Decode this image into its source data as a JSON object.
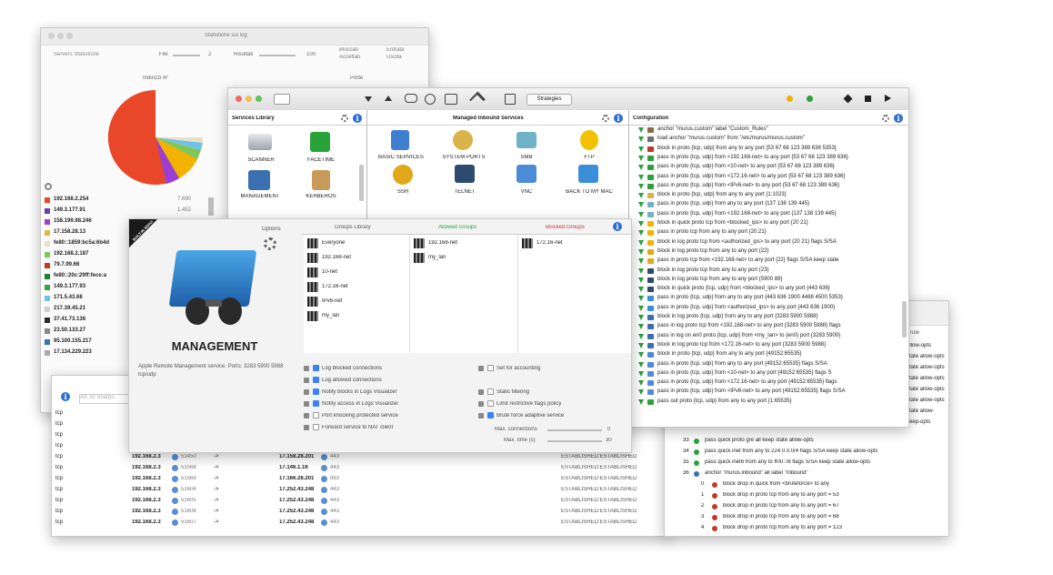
{
  "stats_window": {
    "title": "Statistiche sul log",
    "toolbar": {
      "servers_label": "Servers Statistiche",
      "file_label": "File",
      "file_value": "2",
      "results_label": "Risultati",
      "results_value": "100",
      "radios": [
        "Bloccati",
        "Accettati",
        "Entrata",
        "Uscita"
      ]
    },
    "pie_title": "Indirizzi IP",
    "ports_title": "Porte",
    "legend": [
      {
        "ip": "192.168.2.254",
        "value": "7.690",
        "color": "#e8472a"
      },
      {
        "ip": "149.3.177.91",
        "value": "1.452",
        "color": "#6a3fa8"
      },
      {
        "ip": "158.199.98.246",
        "value": "",
        "color": "#9b3fd0"
      },
      {
        "ip": "17.158.28.13",
        "value": "",
        "color": "#d8c13a"
      },
      {
        "ip": "fe80::1859:bc5a:6b4d",
        "value": "",
        "color": "#e8e0c6"
      },
      {
        "ip": "192.168.2.187",
        "value": "",
        "color": "#7ec85a"
      },
      {
        "ip": "79.7.99.66",
        "value": "",
        "color": "#c1392b"
      },
      {
        "ip": "fe80::20c:29ff:fece:a",
        "value": "",
        "color": "#1d7f3a"
      },
      {
        "ip": "149.3.177.93",
        "value": "",
        "color": "#3aa04a"
      },
      {
        "ip": "171.5.43.68",
        "value": "",
        "color": "#6fc1e8"
      },
      {
        "ip": "217.39.45.21",
        "value": "",
        "color": "#d0d0d0"
      },
      {
        "ip": "37.41.73.136",
        "value": "",
        "color": "#2a2a2a"
      },
      {
        "ip": "23.50.133.27",
        "value": "",
        "color": "#888888"
      },
      {
        "ip": "95.100.155.217",
        "value": "",
        "color": "#3a6fb0"
      },
      {
        "ip": "17.134.229.223",
        "value": "",
        "color": "#aaaaaa"
      }
    ]
  },
  "conn_window": {
    "search_placeholder": "Ad. ID Snarpo",
    "rows": [
      {
        "proto": "tcp",
        "src": "192.168.2.3",
        "sport": "51450",
        "arrow": "->",
        "dst": "17.158.28.201",
        "dport": "443",
        "state": "ESTABLISHED:ESTABLISHED"
      },
      {
        "proto": "tcp",
        "src": "192.168.2.3",
        "sport": "51568",
        "arrow": "->",
        "dst": "17.146.1.16",
        "dport": "443",
        "state": "ESTABLISHED:ESTABLISHED"
      },
      {
        "proto": "tcp",
        "src": "192.168.2.3",
        "sport": "51569",
        "arrow": "->",
        "dst": "17.166.28.201",
        "dport": "993",
        "state": "ESTABLISHED:ESTABLISHED"
      },
      {
        "proto": "tcp",
        "src": "192.168.2.3",
        "sport": "51604",
        "arrow": "->",
        "dst": "17.252.43.248",
        "dport": "443",
        "state": "ESTABLISHED:ESTABLISHED"
      },
      {
        "proto": "tcp",
        "src": "192.168.2.3",
        "sport": "51605",
        "arrow": "->",
        "dst": "17.252.43.248",
        "dport": "443",
        "state": "ESTABLISHED:ESTABLISHED"
      },
      {
        "proto": "tcp",
        "src": "192.168.2.3",
        "sport": "51606",
        "arrow": "->",
        "dst": "17.252.43.248",
        "dport": "443",
        "state": "ESTABLISHED:ESTABLISHED"
      },
      {
        "proto": "tcp",
        "src": "192.168.2.3",
        "sport": "51607",
        "arrow": "->",
        "dst": "17.252.43.248",
        "dport": "443",
        "state": "ESTABLISHED:ESTABLISHED"
      }
    ]
  },
  "rules_window": {
    "header": "rule",
    "right_frag": [
      "allow-opts",
      "state allow-opts",
      "state allow-opts",
      "state allow-opts",
      "state allow-opts",
      "state allow-opts",
      "state allow-",
      "keep-opts"
    ],
    "rows": [
      {
        "num": "33",
        "text": "pass quick proto gre all keep state allow-opts"
      },
      {
        "num": "34",
        "text": "pass quick inet from any to 224.0.0.0/4 flags S/SA keep state allow-opts"
      },
      {
        "num": "35",
        "text": "pass quick inet6 from any to ff00::/8 flags S/SA keep state allow-opts"
      },
      {
        "num": "36",
        "text": "anchor \"murus.inbound\" all label \"Inbound\""
      },
      {
        "num": "0",
        "text": "block drop in quick from <bruteforce> to any"
      },
      {
        "num": "1",
        "text": "block drop in proto tcp from any to any port = 53"
      },
      {
        "num": "2",
        "text": "block drop in proto tcp from any to any port = 67"
      },
      {
        "num": "3",
        "text": "block drop in proto tcp from any to any port = 68"
      },
      {
        "num": "4",
        "text": "block drop in proto tcp from any to any port = 123"
      }
    ]
  },
  "main_window": {
    "toolbar_button": "Strategies",
    "services_library_title": "Services Library",
    "managed_title": "Managed Inbound Services",
    "config_title": "Configuration",
    "library_items": [
      "SCANNER",
      "FACETIME",
      "MANAGEMENT",
      "KERBEROS"
    ],
    "managed_items": [
      "BASIC SERVICES",
      "SYSTEM PORTS",
      "SMB",
      "FTP",
      "SSH",
      "TELNET",
      "VNC",
      "BACK TO MY MAC"
    ],
    "config_lines": [
      "anchor \"murus.custom\" label \"Custom_Rules\"",
      "load anchor \"murus.custom\" from \"/etc/murus/murus.custom\"",
      "block in proto {tcp, udp} from any to any port {53 67 68 123 389 636 5353}",
      "pass in proto {tcp, udp} from <192.168-net> to any port {53 67 68 123 389 636}",
      "pass in proto {tcp, udp} from <10-net> to any port {53 67 68 123 389 636}",
      "pass in proto {tcp, udp} from <172.16-net> to any port {53 67 68 123 389 636}",
      "pass in proto {tcp, udp} from <IPv6-net> to any port {53 67 68 123 389 636}",
      "block in proto {tcp, udp} from any to any port {1:1023}",
      "pass in proto {tcp, udp} from any to any port {137 138 139 445}",
      "pass in proto {tcp, udp} from <192.168-net> to any port {137 138 139 445}",
      "block in quick proto tcp from <blocked_ips> to any port {20 21}",
      "pass in proto tcp from any to any port {20:21}",
      "block in log proto tcp from <authorized_ips> to any port {20 21} flags S/SA",
      "block in log proto tcp from any to any port {22}",
      "pass in proto tcp from <192.168-net> to any port {22} flags S/SA keep state",
      "block in log proto tcp from any to any port {23}",
      "block in log proto tcp from any to any port {5900 88}",
      "block in quick proto {tcp, udp} from <blocked_ips> to any port {443 636}",
      "pass in proto {tcp, udp} from any to any port {443 636 1900 4488 4500 5353}",
      "pass in proto {tcp, udp} from <authorized_ips> to any port {443 636 1900}",
      "block in log proto {tcp, udp} from any to any port {3283 5900 5988}",
      "pass in log proto tcp from <192.168-net> to any port {3283 5900 5988} flags",
      "pass in log on en0 proto {tcp, udp} from <my_lan> to {en0} port {3283 5900}",
      "block in log proto tcp from <172.16-net> to any port {3283 5900 5988}",
      "block in proto {tcp, udp} from any to any port {49152:65535}",
      "pass in proto {tcp, udp} from any to any port {49152:65535} flags S/SA",
      "pass in proto {tcp, udp} from <10-net> to any port {49152:65535} flags S",
      "pass in proto {tcp, udp} from <172.16-net> to any port {49152:65535} flags",
      "pass in proto {tcp, udp} from <IPv6-net> to any port {49152:65535} flags S/SA",
      "pass out proto {tcp, udp} from any to any port {1:65535}"
    ]
  },
  "mgmt_window": {
    "badge": "BUILT-IN SERVICE",
    "options_label": "Options",
    "service_name": "MANAGEMENT",
    "description": "Apple Remote Management service. Ports: 3283 5900 5988 tcp/udp",
    "groups_library_title": "Groups Library",
    "allowed_title": "Allowed Groups",
    "blocked_title": "Blocked Groups",
    "library_groups": [
      "Everyone",
      "192.168-net",
      "10-net",
      "172.16-net",
      "IPv6-net",
      "my_lan"
    ],
    "allowed_groups": [
      "192.168-net",
      "my_lan"
    ],
    "blocked_groups": [
      "172.16-net"
    ],
    "checks_left": [
      {
        "label": "Log blocked connections",
        "on": true
      },
      {
        "label": "Log allowed connections",
        "on": true
      },
      {
        "label": "Notify blocks in Logs Visualizer",
        "on": true
      },
      {
        "label": "Notify access in Logs Visualizer",
        "on": true
      },
      {
        "label": "Port knocking protected service",
        "on": false
      },
      {
        "label": "Forward service to NAT client",
        "on": false
      }
    ],
    "checks_right": [
      {
        "label": "Set for accounting",
        "on": false
      },
      {
        "label": "Static filtering",
        "on": false
      },
      {
        "label": "Limit restrictive flags policy",
        "on": false
      },
      {
        "label": "Brute force adaptive service",
        "on": true
      }
    ],
    "max_conn_label": "Max. connections",
    "max_conn_value": "0",
    "max_time_label": "Max. time (s)",
    "max_time_value": "30"
  },
  "colors": {
    "accent": "#3b82f6",
    "red": "#e8472a",
    "green": "#2aa23a",
    "yellow": "#f2b300"
  }
}
